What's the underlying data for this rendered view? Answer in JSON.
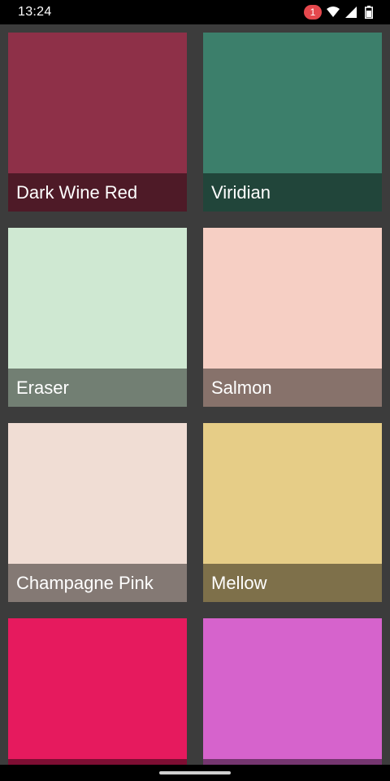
{
  "status_bar": {
    "time": "13:24",
    "notification_count": "1",
    "icons": [
      "wifi-icon",
      "cellular-signal-icon",
      "battery-icon"
    ]
  },
  "colors": {
    "status_bg": "#000000",
    "background": "#3c3c3c",
    "badge": "#e5484d"
  },
  "tiles": [
    {
      "label": "Dark Wine Red",
      "color": "#8e3048"
    },
    {
      "label": "Viridian",
      "color": "#3c7f6b"
    },
    {
      "label": "Eraser",
      "color": "#cfe8d2"
    },
    {
      "label": "Salmon",
      "color": "#f6cfc4"
    },
    {
      "label": "Champagne Pink",
      "color": "#f0ddd4"
    },
    {
      "label": "Mellow",
      "color": "#e6cd87"
    },
    {
      "label": "",
      "color": "#e61a5e"
    },
    {
      "label": "",
      "color": "#d663cc"
    }
  ]
}
